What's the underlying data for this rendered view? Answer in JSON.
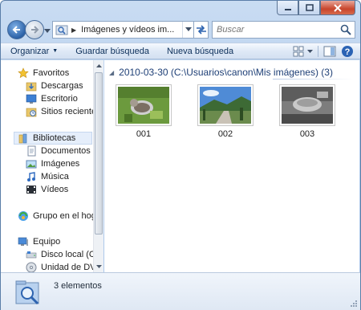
{
  "window": {
    "minimize": "minimize",
    "maximize": "maximize",
    "close": "close"
  },
  "address": {
    "path": "Imágenes y vídeos im..."
  },
  "search": {
    "placeholder": "Buscar"
  },
  "toolbar": {
    "organize": "Organizar",
    "save_search": "Guardar búsqueda",
    "new_search": "Nueva búsqueda"
  },
  "nav": {
    "favorites": "Favoritos",
    "downloads": "Descargas",
    "desktop": "Escritorio",
    "recent": "Sitios recientes",
    "libraries": "Bibliotecas",
    "documents": "Documentos",
    "pictures": "Imágenes",
    "music": "Música",
    "videos": "Vídeos",
    "homegroup": "Grupo en el hogar",
    "computer": "Equipo",
    "local_disk": "Disco local (C:)",
    "dvd": "Unidad de DVD (I"
  },
  "content": {
    "group_header": "2010-03-30 (C:\\Usuarios\\canon\\Mis imágenes) (3)",
    "items": [
      {
        "name": "001",
        "icon": "photo-cat-grass"
      },
      {
        "name": "002",
        "icon": "photo-mountain-road"
      },
      {
        "name": "003",
        "icon": "photo-bowl-grayscale"
      }
    ]
  },
  "details": {
    "count": "3 elementos"
  },
  "colors": {
    "accent": "#1e3f76",
    "toolbar_text": "#0b2e59"
  }
}
